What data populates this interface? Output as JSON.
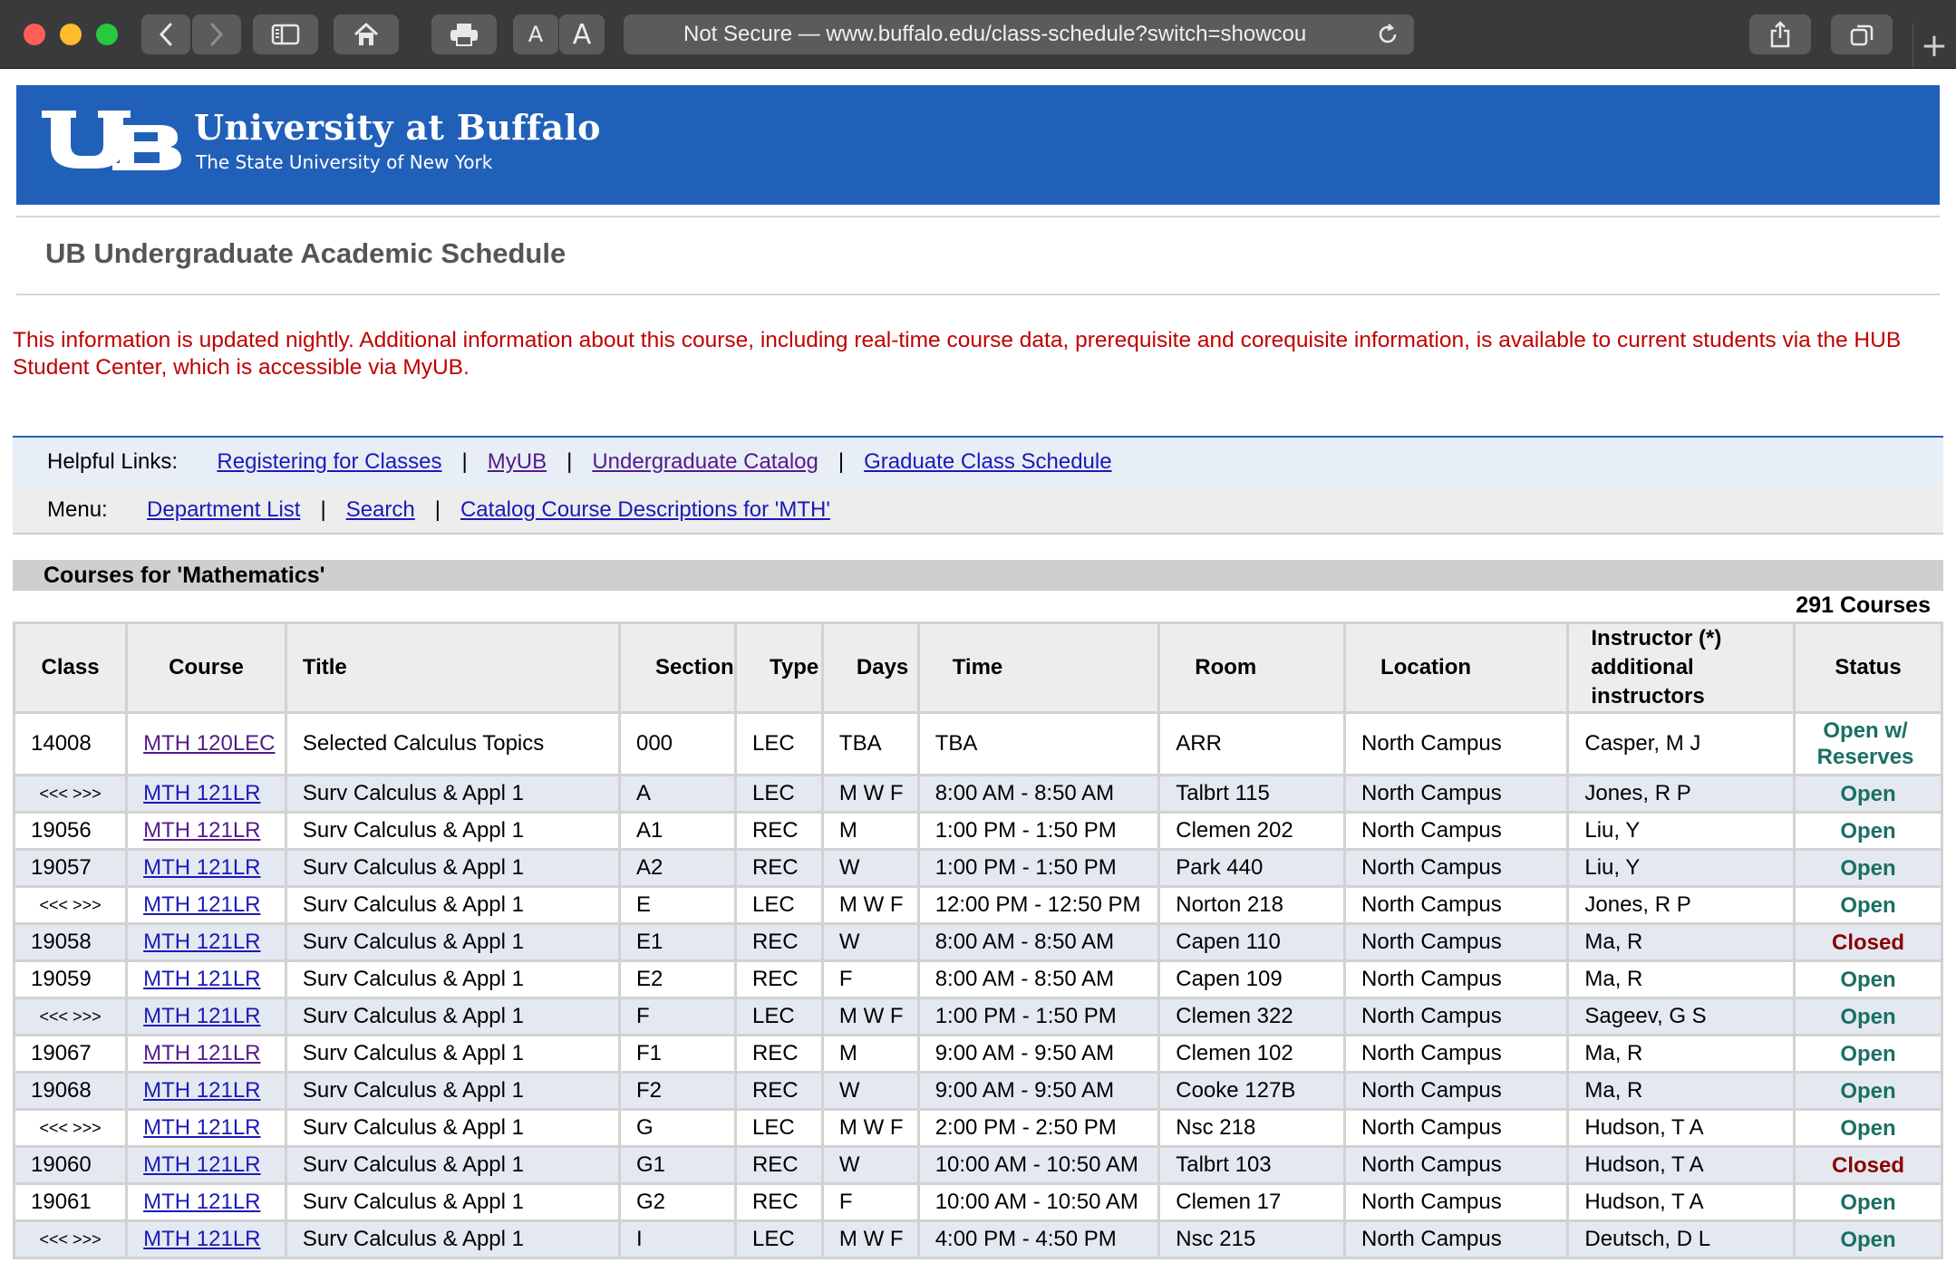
{
  "browser": {
    "url_display": "Not Secure — www.buffalo.edu/class-schedule?switch=showcou",
    "font_small_label": "A",
    "font_large_label": "A",
    "new_tab_label": "+"
  },
  "banner": {
    "name": "University at Buffalo",
    "subtitle": "The State University of New York"
  },
  "page_title": "UB Undergraduate Academic Schedule",
  "notice": "This information is updated nightly. Additional information about this course, including real-time course data, prerequisite and corequisite information, is available to current students via the HUB Student Center, which is accessible via MyUB.",
  "helpful_links": {
    "label": "Helpful Links:",
    "separator": "|",
    "items": [
      {
        "label": "Registering for Classes",
        "visited": false
      },
      {
        "label": "MyUB",
        "visited": true
      },
      {
        "label": "Undergraduate Catalog",
        "visited": true
      },
      {
        "label": "Graduate Class Schedule",
        "visited": false
      }
    ]
  },
  "menu": {
    "label": "Menu:",
    "separator": "|",
    "items": [
      {
        "label": "Department List"
      },
      {
        "label": "Search"
      },
      {
        "label": "Catalog Course Descriptions for 'MTH'"
      }
    ]
  },
  "courses": {
    "heading": "Courses for 'Mathematics'",
    "count": "291 Courses",
    "columns": [
      "Class",
      "Course",
      "Title",
      "Section",
      "Type",
      "Days",
      "Time",
      "Room",
      "Location",
      "Instructor (*) additional instructors",
      "Status"
    ],
    "rows": [
      {
        "class": "14008",
        "course": "MTH 120LEC",
        "title": "Selected Calculus Topics",
        "section": "000",
        "type": "LEC",
        "days": "TBA",
        "time": "TBA",
        "room": "ARR",
        "location": "North Campus",
        "instructor": "Casper, M J",
        "status": "Open w/ Reserves",
        "status_kind": "open",
        "visited": true
      },
      {
        "class": "<<< >>>",
        "course": "MTH 121LR",
        "title": "Surv Calculus & Appl 1",
        "section": "A",
        "type": "LEC",
        "days": "M W F",
        "time": "8:00 AM - 8:50 AM",
        "room": "Talbrt 115",
        "location": "North Campus",
        "instructor": "Jones, R P",
        "status": "Open",
        "status_kind": "open",
        "visited": false
      },
      {
        "class": "19056",
        "course": "MTH 121LR",
        "title": "Surv Calculus & Appl 1",
        "section": "A1",
        "type": "REC",
        "days": "M",
        "time": "1:00 PM - 1:50 PM",
        "room": "Clemen 202",
        "location": "North Campus",
        "instructor": "Liu, Y",
        "status": "Open",
        "status_kind": "open",
        "visited": true
      },
      {
        "class": "19057",
        "course": "MTH 121LR",
        "title": "Surv Calculus & Appl 1",
        "section": "A2",
        "type": "REC",
        "days": "W",
        "time": "1:00 PM - 1:50 PM",
        "room": "Park 440",
        "location": "North Campus",
        "instructor": "Liu, Y",
        "status": "Open",
        "status_kind": "open",
        "visited": false
      },
      {
        "class": "<<< >>>",
        "course": "MTH 121LR",
        "title": "Surv Calculus & Appl 1",
        "section": "E",
        "type": "LEC",
        "days": "M W F",
        "time": "12:00 PM - 12:50 PM",
        "room": "Norton 218",
        "location": "North Campus",
        "instructor": "Jones, R P",
        "status": "Open",
        "status_kind": "open",
        "visited": false
      },
      {
        "class": "19058",
        "course": "MTH 121LR",
        "title": "Surv Calculus & Appl 1",
        "section": "E1",
        "type": "REC",
        "days": "W",
        "time": "8:00 AM - 8:50 AM",
        "room": "Capen 110",
        "location": "North Campus",
        "instructor": "Ma, R",
        "status": "Closed",
        "status_kind": "closed",
        "visited": false
      },
      {
        "class": "19059",
        "course": "MTH 121LR",
        "title": "Surv Calculus & Appl 1",
        "section": "E2",
        "type": "REC",
        "days": "F",
        "time": "8:00 AM - 8:50 AM",
        "room": "Capen 109",
        "location": "North Campus",
        "instructor": "Ma, R",
        "status": "Open",
        "status_kind": "open",
        "visited": false
      },
      {
        "class": "<<< >>>",
        "course": "MTH 121LR",
        "title": "Surv Calculus & Appl 1",
        "section": "F",
        "type": "LEC",
        "days": "M W F",
        "time": "1:00 PM - 1:50 PM",
        "room": "Clemen 322",
        "location": "North Campus",
        "instructor": "Sageev, G S",
        "status": "Open",
        "status_kind": "open",
        "visited": false
      },
      {
        "class": "19067",
        "course": "MTH 121LR",
        "title": "Surv Calculus & Appl 1",
        "section": "F1",
        "type": "REC",
        "days": "M",
        "time": "9:00 AM - 9:50 AM",
        "room": "Clemen 102",
        "location": "North Campus",
        "instructor": "Ma, R",
        "status": "Open",
        "status_kind": "open",
        "visited": true
      },
      {
        "class": "19068",
        "course": "MTH 121LR",
        "title": "Surv Calculus & Appl 1",
        "section": "F2",
        "type": "REC",
        "days": "W",
        "time": "9:00 AM - 9:50 AM",
        "room": "Cooke 127B",
        "location": "North Campus",
        "instructor": "Ma, R",
        "status": "Open",
        "status_kind": "open",
        "visited": false
      },
      {
        "class": "<<< >>>",
        "course": "MTH 121LR",
        "title": "Surv Calculus & Appl 1",
        "section": "G",
        "type": "LEC",
        "days": "M W F",
        "time": "2:00 PM - 2:50 PM",
        "room": "Nsc 218",
        "location": "North Campus",
        "instructor": "Hudson, T A",
        "status": "Open",
        "status_kind": "open",
        "visited": false
      },
      {
        "class": "19060",
        "course": "MTH 121LR",
        "title": "Surv Calculus & Appl 1",
        "section": "G1",
        "type": "REC",
        "days": "W",
        "time": "10:00 AM - 10:50 AM",
        "room": "Talbrt 103",
        "location": "North Campus",
        "instructor": "Hudson, T A",
        "status": "Closed",
        "status_kind": "closed",
        "visited": false
      },
      {
        "class": "19061",
        "course": "MTH 121LR",
        "title": "Surv Calculus & Appl 1",
        "section": "G2",
        "type": "REC",
        "days": "F",
        "time": "10:00 AM - 10:50 AM",
        "room": "Clemen 17",
        "location": "North Campus",
        "instructor": "Hudson, T A",
        "status": "Open",
        "status_kind": "open",
        "visited": false
      },
      {
        "class": "<<< >>>",
        "course": "MTH 121LR",
        "title": "Surv Calculus & Appl 1",
        "section": "I",
        "type": "LEC",
        "days": "M W F",
        "time": "4:00 PM - 4:50 PM",
        "room": "Nsc 215",
        "location": "North Campus",
        "instructor": "Deutsch, D L",
        "status": "Open",
        "status_kind": "open",
        "visited": false
      }
    ]
  },
  "colors": {
    "banner_blue": "#2160b9",
    "notice_red": "#c00000",
    "status_open": "#1b6f63",
    "status_closed": "#8b0000",
    "row_alt": "#e4e9f1"
  }
}
